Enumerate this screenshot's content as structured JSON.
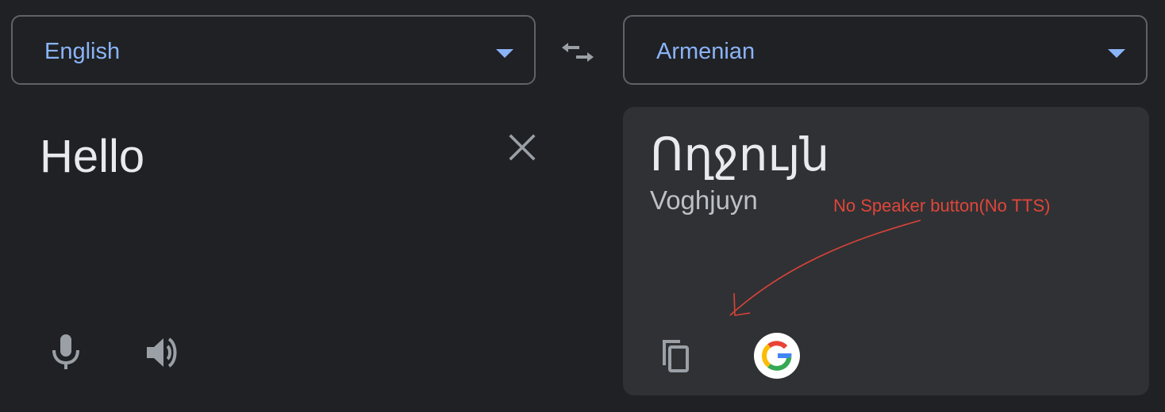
{
  "source_language": {
    "label": "English",
    "icon": "dropdown-triangle-icon"
  },
  "swap": {
    "icon": "swap-arrows-icon"
  },
  "target_language": {
    "label": "Armenian",
    "icon": "dropdown-triangle-icon"
  },
  "source": {
    "text": "Hello",
    "clear_icon": "close-icon",
    "mic_icon": "microphone-icon",
    "speaker_icon": "speaker-icon"
  },
  "target": {
    "translation": "Ողջույն",
    "transliteration": "Voghjuyn",
    "copy_icon": "copy-icon",
    "google_icon": "google-logo-icon"
  },
  "annotation": {
    "text": "No Speaker button(No TTS)"
  },
  "colors": {
    "background": "#202124",
    "panel": "#303134",
    "accent": "#8ab4f8",
    "text": "#e8eaed",
    "annotation": "#e0463a"
  }
}
